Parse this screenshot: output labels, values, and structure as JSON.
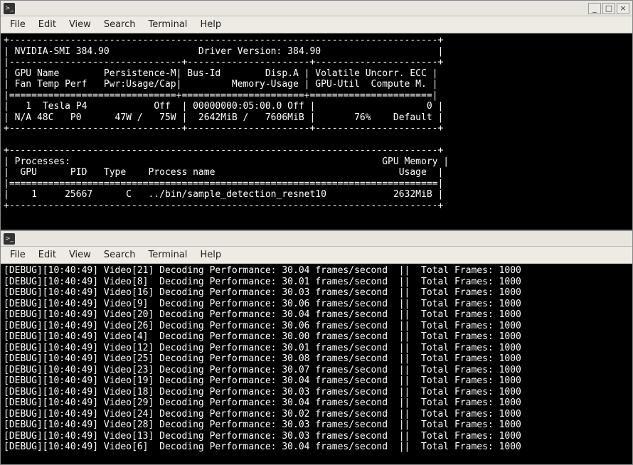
{
  "menu": {
    "file": "File",
    "edit": "Edit",
    "view": "View",
    "search": "Search",
    "terminal": "Terminal",
    "help": "Help"
  },
  "titlebar": {
    "icon": ">_",
    "min": "_",
    "max": "□",
    "close": "×"
  },
  "smi": {
    "version": "384.90",
    "driver": "384.90",
    "hdr": {
      "gpu": "GPU",
      "name": "Name",
      "persist": "Persistence-M",
      "busid": "Bus-Id",
      "dispa": "Disp.A",
      "volatile": "Volatile",
      "uncorr": "Uncorr. ECC",
      "fan": "Fan",
      "temp": "Temp",
      "perf": "Perf",
      "pwr": "Pwr:Usage/Cap",
      "mem": "Memory-Usage",
      "gpuutil": "GPU-Util",
      "compute": "Compute M."
    },
    "row": {
      "idx": "1",
      "model": "Tesla P4",
      "persist": "Off",
      "bus": "00000000:05:00.0",
      "disp": "Off",
      "ecc": "0",
      "fan": "N/A",
      "temp": "48C",
      "perf": "P0",
      "pwrU": "47W",
      "pwrC": "75W",
      "memU": "2642MiB",
      "memT": "7606MiB",
      "util": "76%",
      "comp": "Default"
    },
    "proc": {
      "title": "Processes:",
      "gpu": "GPU",
      "pid": "PID",
      "type": "Type",
      "pname": "Process name",
      "gmem1": "GPU Memory",
      "gmem2": "Usage",
      "r_gpu": "1",
      "r_pid": "25667",
      "r_type": "C",
      "r_name": "../bin/sample_detection_resnet10",
      "r_usage": "2632MiB"
    }
  },
  "log": {
    "prefix": "[DEBUG][10:40:49]",
    "total_label": "Total Frames:",
    "total": "1000",
    "unit": "frames/second",
    "mid": "Decoding Performance:",
    "rows": [
      {
        "id": "21",
        "fps": "30.04"
      },
      {
        "id": "8",
        "fps": "30.01"
      },
      {
        "id": "16",
        "fps": "30.03"
      },
      {
        "id": "9",
        "fps": "30.06"
      },
      {
        "id": "20",
        "fps": "30.04"
      },
      {
        "id": "26",
        "fps": "30.06"
      },
      {
        "id": "4",
        "fps": "30.00"
      },
      {
        "id": "12",
        "fps": "30.01"
      },
      {
        "id": "25",
        "fps": "30.08"
      },
      {
        "id": "23",
        "fps": "30.07"
      },
      {
        "id": "19",
        "fps": "30.04"
      },
      {
        "id": "18",
        "fps": "30.03"
      },
      {
        "id": "29",
        "fps": "30.04"
      },
      {
        "id": "24",
        "fps": "30.02"
      },
      {
        "id": "28",
        "fps": "30.03"
      },
      {
        "id": "13",
        "fps": "30.03"
      },
      {
        "id": "6",
        "fps": "30.04"
      }
    ]
  }
}
